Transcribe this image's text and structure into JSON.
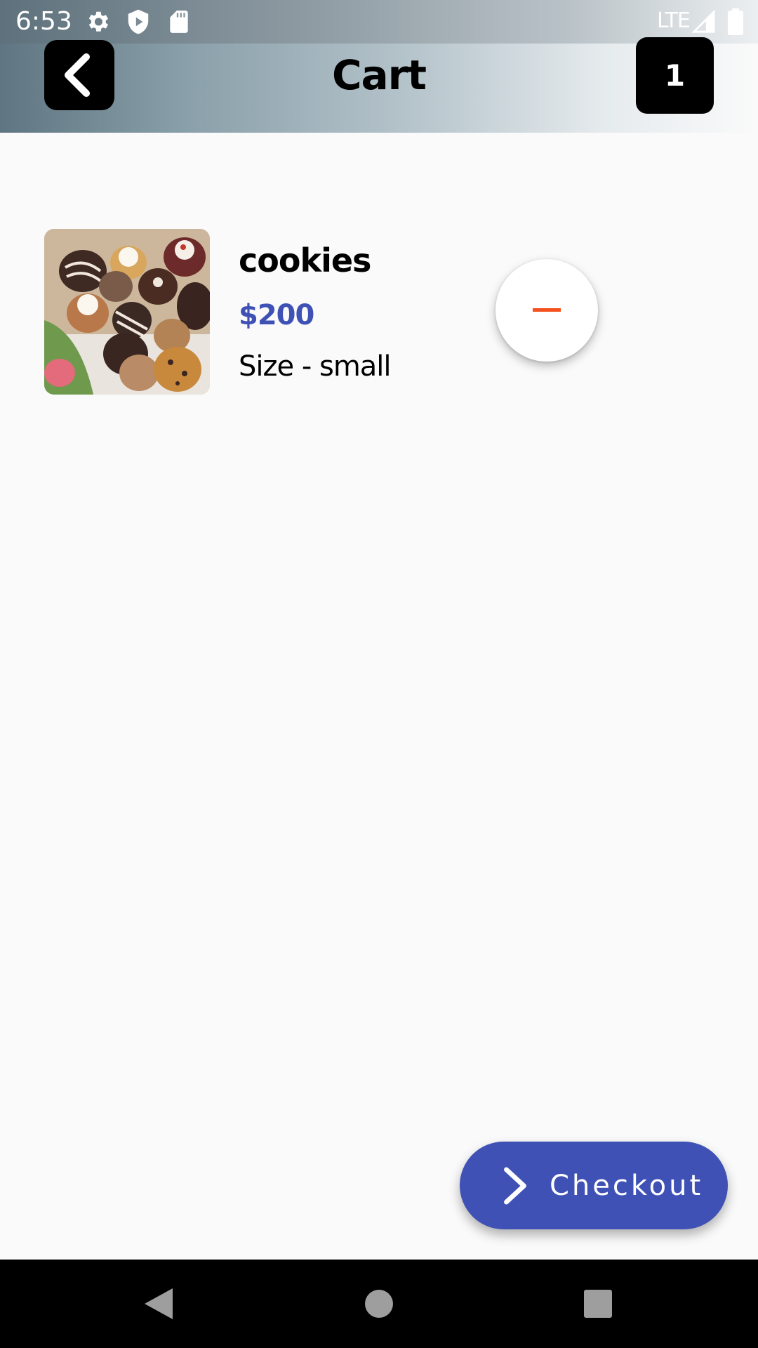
{
  "status_bar": {
    "time": "6:53",
    "network": "LTE",
    "icons": [
      "settings-gear-icon",
      "shield-icon",
      "sd-card-icon",
      "signal-icon",
      "battery-icon"
    ]
  },
  "header": {
    "title": "Cart",
    "cart_count": "1",
    "back_icon": "chevron-left-icon"
  },
  "cart": {
    "items": [
      {
        "name": "cookies",
        "price": "$200",
        "size": "Size - small",
        "image": "assorted cookies photo",
        "remove_icon": "minus-icon"
      }
    ]
  },
  "checkout": {
    "label": "Checkout",
    "icon": "chevron-right-icon"
  },
  "nav_bar": {
    "icons": [
      "back-triangle-icon",
      "home-circle-icon",
      "recents-square-icon"
    ]
  },
  "colors": {
    "accent": "#3f51b5",
    "remove": "#f4511e",
    "background": "#fafafa"
  }
}
